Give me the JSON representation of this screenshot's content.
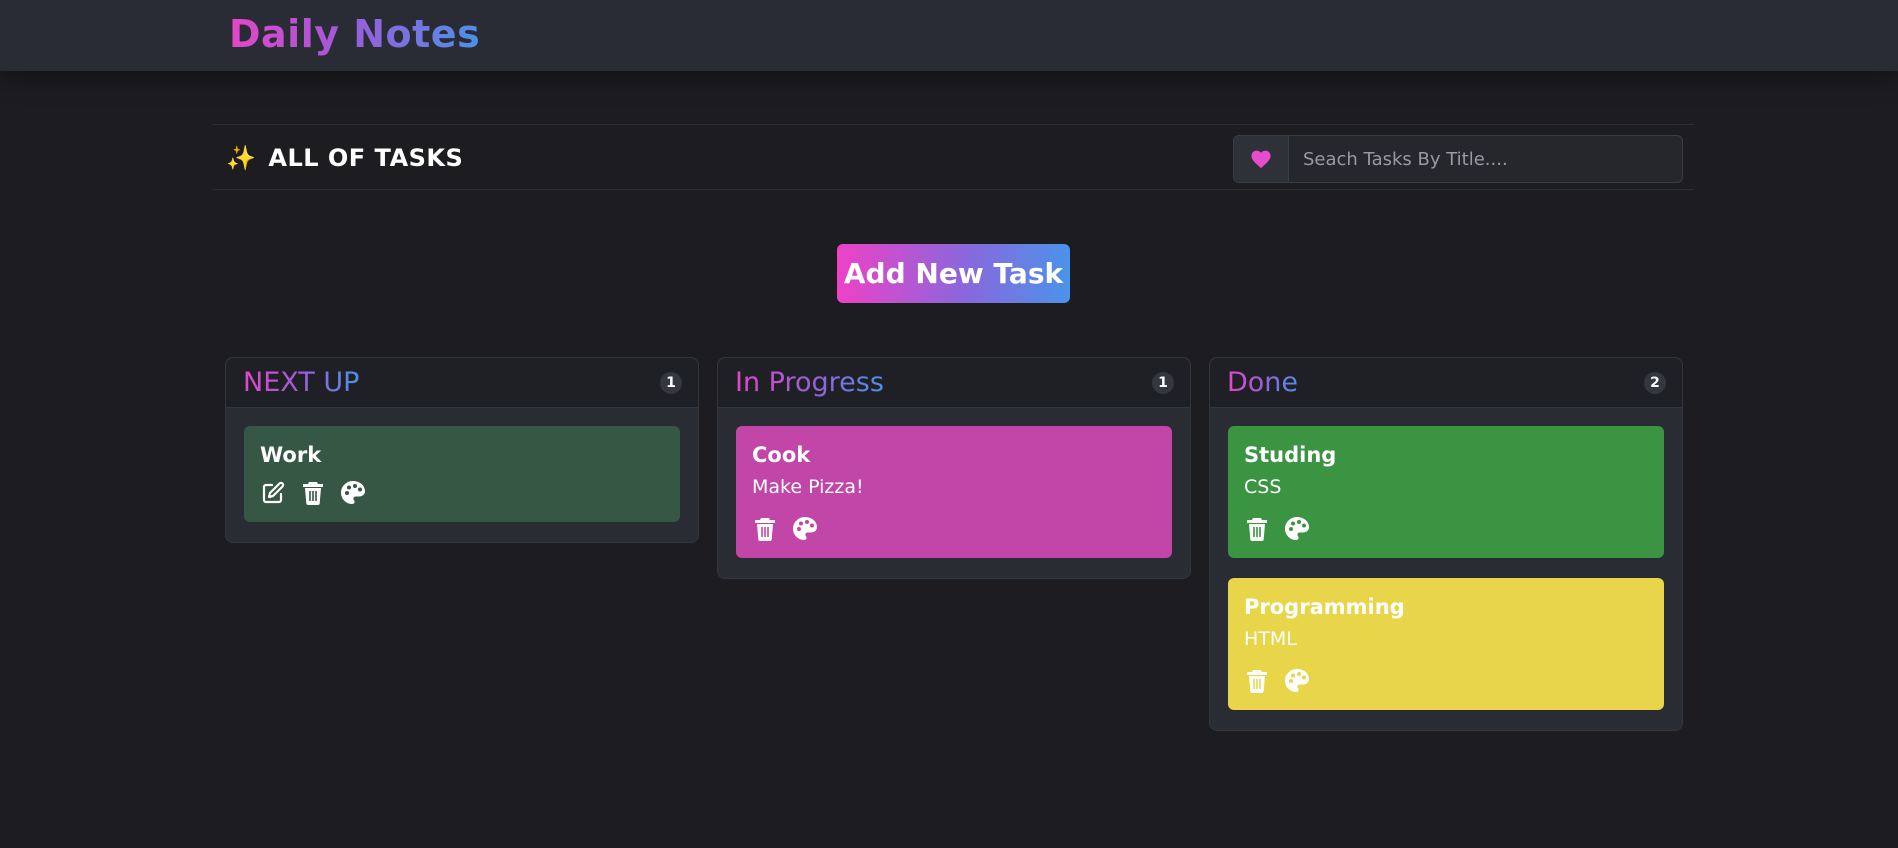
{
  "app": {
    "title": "Daily Notes",
    "accent_gradient": [
      "#e546c8",
      "#4d90e8"
    ]
  },
  "toolbar": {
    "heading": "ALL OF TASKS",
    "heading_icon": "sparkles-icon",
    "search": {
      "placeholder": "Seach Tasks By Title....",
      "value": "",
      "icon": "heart-icon"
    }
  },
  "add_button": {
    "label": "Add New Task"
  },
  "columns": [
    {
      "title": "NEXT UP",
      "count": "1",
      "cards": [
        {
          "title": "Work",
          "description": "",
          "color": "#365744",
          "actions": [
            "edit-icon",
            "trash-icon",
            "palette-icon"
          ]
        }
      ]
    },
    {
      "title": "In Progress",
      "count": "1",
      "cards": [
        {
          "title": "Cook",
          "description": "Make Pizza!",
          "color": "#c245a8",
          "actions": [
            "trash-icon",
            "palette-icon"
          ]
        }
      ]
    },
    {
      "title": "Done",
      "count": "2",
      "cards": [
        {
          "title": "Studing",
          "description": "CSS",
          "color": "#3a9442",
          "actions": [
            "trash-icon",
            "palette-icon"
          ]
        },
        {
          "title": "Programming",
          "description": "HTML",
          "color": "#e9d54a",
          "actions": [
            "trash-icon",
            "palette-icon"
          ]
        }
      ]
    }
  ]
}
